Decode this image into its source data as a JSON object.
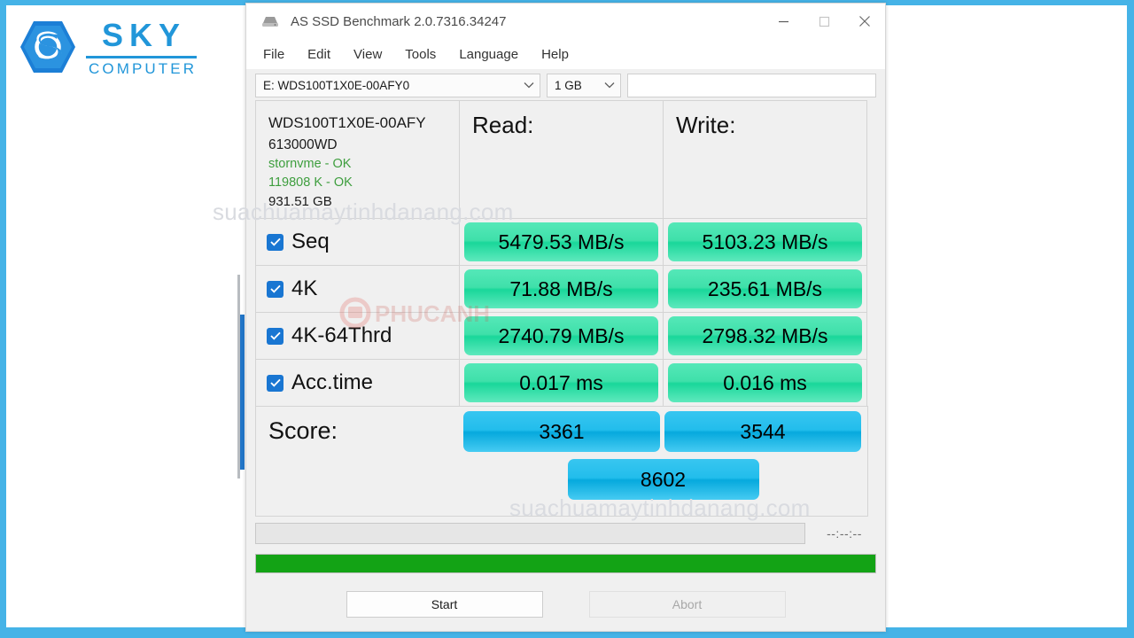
{
  "branding": {
    "name_primary": "SKY",
    "name_secondary": "COMPUTER",
    "logo_icon": "hexagon-s-logo-icon",
    "accent_color": "#2196d9"
  },
  "page_frame": {
    "border_color": "#45b3e7"
  },
  "window": {
    "title": "AS SSD Benchmark 2.0.7316.34247",
    "title_icon": "hard-drive-icon",
    "controls": [
      {
        "name": "minimize",
        "glyph": "minimize-icon"
      },
      {
        "name": "maximize",
        "glyph": "maximize-icon"
      },
      {
        "name": "close",
        "glyph": "close-icon"
      }
    ]
  },
  "menu": {
    "items": [
      {
        "label": "File"
      },
      {
        "label": "Edit"
      },
      {
        "label": "View"
      },
      {
        "label": "Tools"
      },
      {
        "label": "Language"
      },
      {
        "label": "Help"
      }
    ]
  },
  "toolbar": {
    "drive_select": {
      "value": "E: WDS100T1X0E-00AFY0",
      "icon": "chevron-down-icon"
    },
    "size_select": {
      "value": "1 GB",
      "icon": "chevron-down-icon"
    },
    "name_field": {
      "value": "",
      "placeholder": ""
    }
  },
  "drive_info": {
    "model": "WDS100T1X0E-00AFY",
    "firmware": "613000WD",
    "driver_status": "stornvme - OK",
    "alignment_status": "119808 K - OK",
    "capacity": "931.51 GB"
  },
  "columns": {
    "read_header": "Read:",
    "write_header": "Write:"
  },
  "benchmarks": [
    {
      "label": "Seq",
      "checked": true,
      "read": "5479.53 MB/s",
      "write": "5103.23 MB/s"
    },
    {
      "label": "4K",
      "checked": true,
      "read": "71.88 MB/s",
      "write": "235.61 MB/s"
    },
    {
      "label": "4K-64Thrd",
      "checked": true,
      "read": "2740.79 MB/s",
      "write": "2798.32 MB/s"
    },
    {
      "label": "Acc.time",
      "checked": true,
      "read": "0.017 ms",
      "write": "0.016 ms"
    }
  ],
  "score": {
    "label": "Score:",
    "read": "3361",
    "write": "3544",
    "total": "8602"
  },
  "status": {
    "progress_label": "",
    "timer": "--:--:--",
    "progress_percent": 100,
    "progress_color": "#13a315"
  },
  "actions": {
    "start_label": "Start",
    "abort_label": "Abort"
  },
  "watermarks": {
    "site": "suachuamaytinhdanang.com",
    "site_2": "suachuamaytinhdanang.com"
  },
  "colors": {
    "speed_pill": "#2ddba0",
    "score_pill": "#1fbcec",
    "checkbox": "#1976d2",
    "ok_text": "#3e9e3e"
  }
}
